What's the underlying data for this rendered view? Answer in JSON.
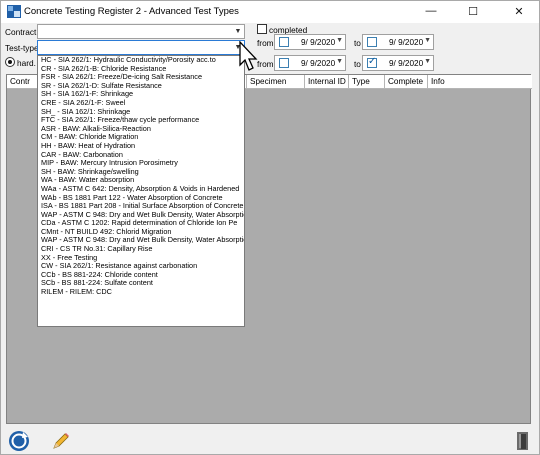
{
  "window": {
    "title": "Concrete Testing Register 2 - Advanced Test Types",
    "minimize": "—",
    "maximize": "☐",
    "close": "✕"
  },
  "filters": {
    "contract_label": "Contract",
    "testtype_label": "Test-type",
    "completed_label": "completed",
    "from_label": "from",
    "to_label": "to",
    "date1_from": "9/ 9/2020",
    "date1_to": "9/ 9/2020",
    "date2_from": "9/ 9/2020",
    "date2_to": "9/ 9/2020",
    "hard_label": "hard."
  },
  "grid": {
    "columns": [
      "Contr",
      "",
      "Specimen",
      "Internal ID",
      "Type",
      "Complete",
      "Info"
    ]
  },
  "dropdown": {
    "items": [
      "HC - SIA 262/1: Hydraulic Conductivity/Porosity acc.to",
      "CR - SIA 262/1-B: Chloride Resistance",
      "FSR - SIA 262/1: Freeze/De-icing Salt Resistance",
      "SR - SIA 262/1-D: Sulfate Resistance",
      "SH - SIA 162/1-F: Shrinkage",
      "CRE - SIA 262/1-F: Sweel",
      "SH_ - SIA 162/1: Shrinkage",
      "FTC - SIA 262/1: Freeze/thaw cycle performance",
      "ASR - BAW: Alkali-Silica-Reaction",
      "CM - BAW: Chloride Migration",
      "HH - BAW: Heat of Hydration",
      "CAR - BAW: Carbonation",
      "MIP - BAW: Mercury Intrusion Porosimetry",
      "SH - BAW: Shrinkage/swelling",
      "WA - BAW: Water absorption",
      "WAa - ASTM C 642: Density, Absorption & Voids in Hardened",
      "WAb - BS 1881 Part 122 - Water Absorption of Concrete",
      "ISA - BS 1881 Part 208 - Initial Surface Absorption of Concrete",
      "WAP - ASTM C 948: Dry and Wet Bulk Density, Water Absorption",
      "CDa - ASTM C 1202: Rapid determination of Chloride Ion Pe",
      "CMnt - NT BUILD 492: Chlorid Migration",
      "WAP - ASTM C 948: Dry and Wet Bulk Density, Water Absorption",
      "CRI - CS TR No.31: Capillary Rise",
      "XX - Free Testing",
      "CW - SIA 262/1: Resistance against carbonation",
      "CCb - BS 881-224: Chloride content",
      "SCb - BS 881-224: Sulfate content",
      "RILEM - RILEM: CDC"
    ]
  },
  "colors": {
    "accent": "#2a7ad5",
    "grid_bg": "#ababab",
    "window_bg": "#f0f0f0"
  }
}
